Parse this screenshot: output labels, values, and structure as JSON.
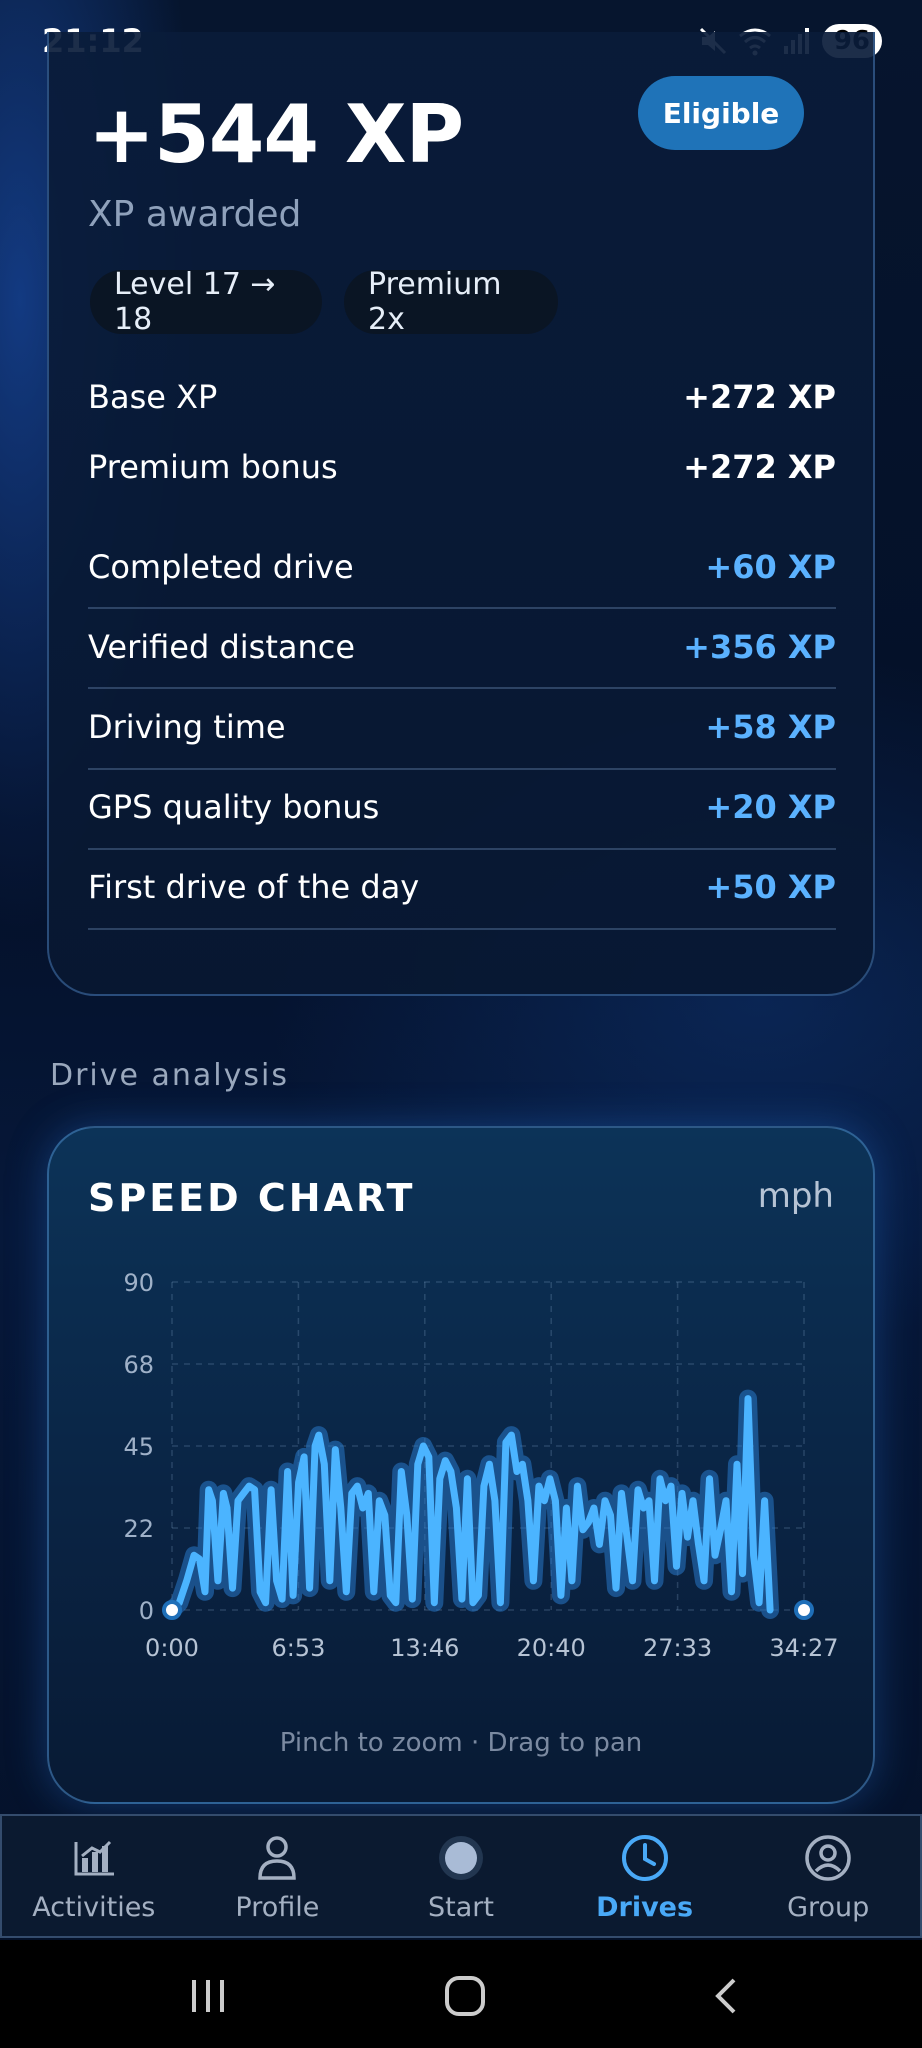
{
  "status": {
    "time": "21:12",
    "battery": "96"
  },
  "xp": {
    "total": "+544 XP",
    "subtitle": "XP awarded",
    "badge": "Eligible",
    "chips": [
      "Level 17 → 18",
      "Premium 2x"
    ],
    "summary": [
      {
        "label": "Base XP",
        "value": "+272 XP"
      },
      {
        "label": "Premium bonus",
        "value": "+272 XP"
      }
    ],
    "breakdown": [
      {
        "label": "Completed drive",
        "value": "+60 XP"
      },
      {
        "label": "Verified distance",
        "value": "+356 XP"
      },
      {
        "label": "Driving time",
        "value": "+58 XP"
      },
      {
        "label": "GPS quality bonus",
        "value": "+20 XP"
      },
      {
        "label": "First drive of the day",
        "value": "+50 XP"
      }
    ]
  },
  "section_title": "Drive analysis",
  "chart": {
    "title": "SPEED CHART",
    "unit": "mph",
    "hint": "Pinch to zoom · Drag to pan"
  },
  "chart_data": {
    "type": "line",
    "title": "SPEED CHART",
    "ylabel": "mph",
    "x_tick_labels": [
      "0:00",
      "6:53",
      "13:46",
      "20:40",
      "27:33",
      "34:27"
    ],
    "y_tick_labels": [
      "0",
      "22",
      "45",
      "68",
      "90"
    ],
    "xlim_minutes": [
      0,
      34.45
    ],
    "ylim": [
      0,
      90
    ],
    "grid": true,
    "line_color": "#4bb4ff",
    "x_minutes": [
      0,
      0.4,
      0.8,
      1.2,
      1.5,
      1.8,
      2.0,
      2.2,
      2.5,
      2.8,
      3.0,
      3.3,
      3.6,
      3.9,
      4.2,
      4.5,
      4.8,
      5.1,
      5.4,
      5.7,
      6.0,
      6.3,
      6.6,
      6.9,
      7.2,
      7.5,
      7.8,
      8.0,
      8.3,
      8.6,
      8.9,
      9.2,
      9.5,
      9.8,
      10.1,
      10.4,
      10.7,
      11.0,
      11.3,
      11.6,
      11.9,
      12.2,
      12.5,
      12.8,
      13.1,
      13.4,
      13.7,
      14.0,
      14.3,
      14.6,
      14.9,
      15.2,
      15.5,
      15.8,
      16.1,
      16.4,
      16.7,
      17.0,
      17.3,
      17.6,
      17.9,
      18.2,
      18.5,
      18.8,
      19.1,
      19.4,
      19.7,
      20.0,
      20.3,
      20.6,
      20.9,
      21.2,
      21.5,
      21.8,
      22.1,
      22.4,
      22.7,
      23.0,
      23.3,
      23.6,
      23.9,
      24.2,
      24.5,
      24.8,
      25.1,
      25.4,
      25.7,
      26.0,
      26.3,
      26.6,
      26.9,
      27.2,
      27.5,
      27.8,
      28.1,
      28.4,
      28.7,
      29.0,
      29.3,
      29.6,
      29.9,
      30.2,
      30.5,
      30.8,
      31.1,
      31.4,
      31.7,
      32.0,
      32.3,
      32.6,
      32.9,
      33.2,
      33.5,
      33.8,
      34.1,
      34.45
    ],
    "y_mph": [
      0,
      2,
      8,
      15,
      14,
      5,
      33,
      30,
      8,
      32,
      28,
      6,
      30,
      32,
      34,
      33,
      5,
      2,
      33,
      8,
      3,
      38,
      4,
      35,
      42,
      6,
      45,
      48,
      40,
      8,
      44,
      28,
      5,
      32,
      34,
      28,
      32,
      5,
      30,
      26,
      4,
      2,
      38,
      26,
      3,
      40,
      45,
      42,
      2,
      36,
      41,
      38,
      28,
      3,
      36,
      2,
      4,
      34,
      40,
      30,
      2,
      46,
      48,
      38,
      40,
      30,
      8,
      34,
      30,
      36,
      30,
      4,
      28,
      8,
      34,
      22,
      24,
      28,
      18,
      30,
      26,
      6,
      32,
      20,
      8,
      33,
      28,
      30,
      8,
      36,
      30,
      34,
      12,
      32,
      20,
      30,
      18,
      8,
      36,
      15,
      22,
      30,
      5,
      40,
      10,
      58,
      15,
      2,
      30,
      0
    ],
    "start_marker": {
      "x_minutes": 0,
      "y_mph": 0
    },
    "end_marker": {
      "x_minutes": 34.45,
      "y_mph": 0
    }
  },
  "nav": {
    "items": [
      {
        "label": "Activities",
        "icon": "bar-chart-icon"
      },
      {
        "label": "Profile",
        "icon": "person-icon"
      },
      {
        "label": "Start",
        "icon": "record-dot-icon"
      },
      {
        "label": "Drives",
        "icon": "clock-icon"
      },
      {
        "label": "Group",
        "icon": "group-icon"
      }
    ],
    "active": "Drives"
  },
  "colors": {
    "accent": "#49a9f7",
    "positive_xp": "#5bb2ff",
    "eligible_badge": "#1f73b8",
    "chart_line": "#4bb4ff"
  }
}
